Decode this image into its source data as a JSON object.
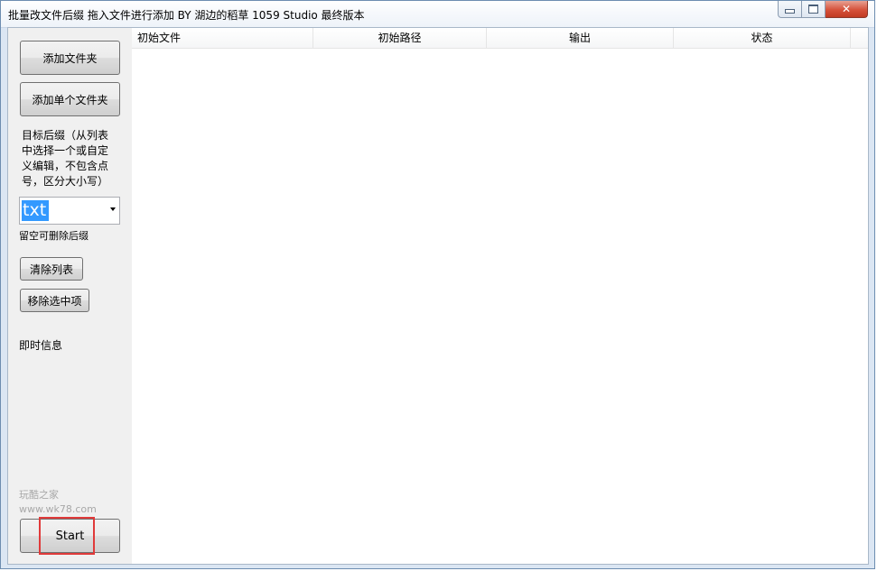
{
  "window": {
    "title": "批量改文件后缀    拖入文件进行添加    BY 湖边的稻草 1059 Studio 最终版本",
    "close_glyph": "✕"
  },
  "left_panel": {
    "add_folder_label": "添加文件夹",
    "add_single_folder_label": "添加单个文件夹",
    "suffix_label": "目标后缀（从列表中选择一个或自定义编辑，不包含点号，区分大小写）",
    "suffix_value": "txt",
    "empty_hint": "留空可删除后缀",
    "clear_list_label": "清除列表",
    "remove_selected_label": "移除选中项",
    "info_label": "即时信息",
    "watermark_line1": "玩酷之家",
    "watermark_line2": "www.wk78.com",
    "start_label": "Start"
  },
  "list": {
    "columns": [
      "初始文件",
      "初始路径",
      "输出",
      "状态"
    ],
    "rows": []
  },
  "colors": {
    "highlight_box": "#e03a3a",
    "selection": "#3399ff"
  }
}
